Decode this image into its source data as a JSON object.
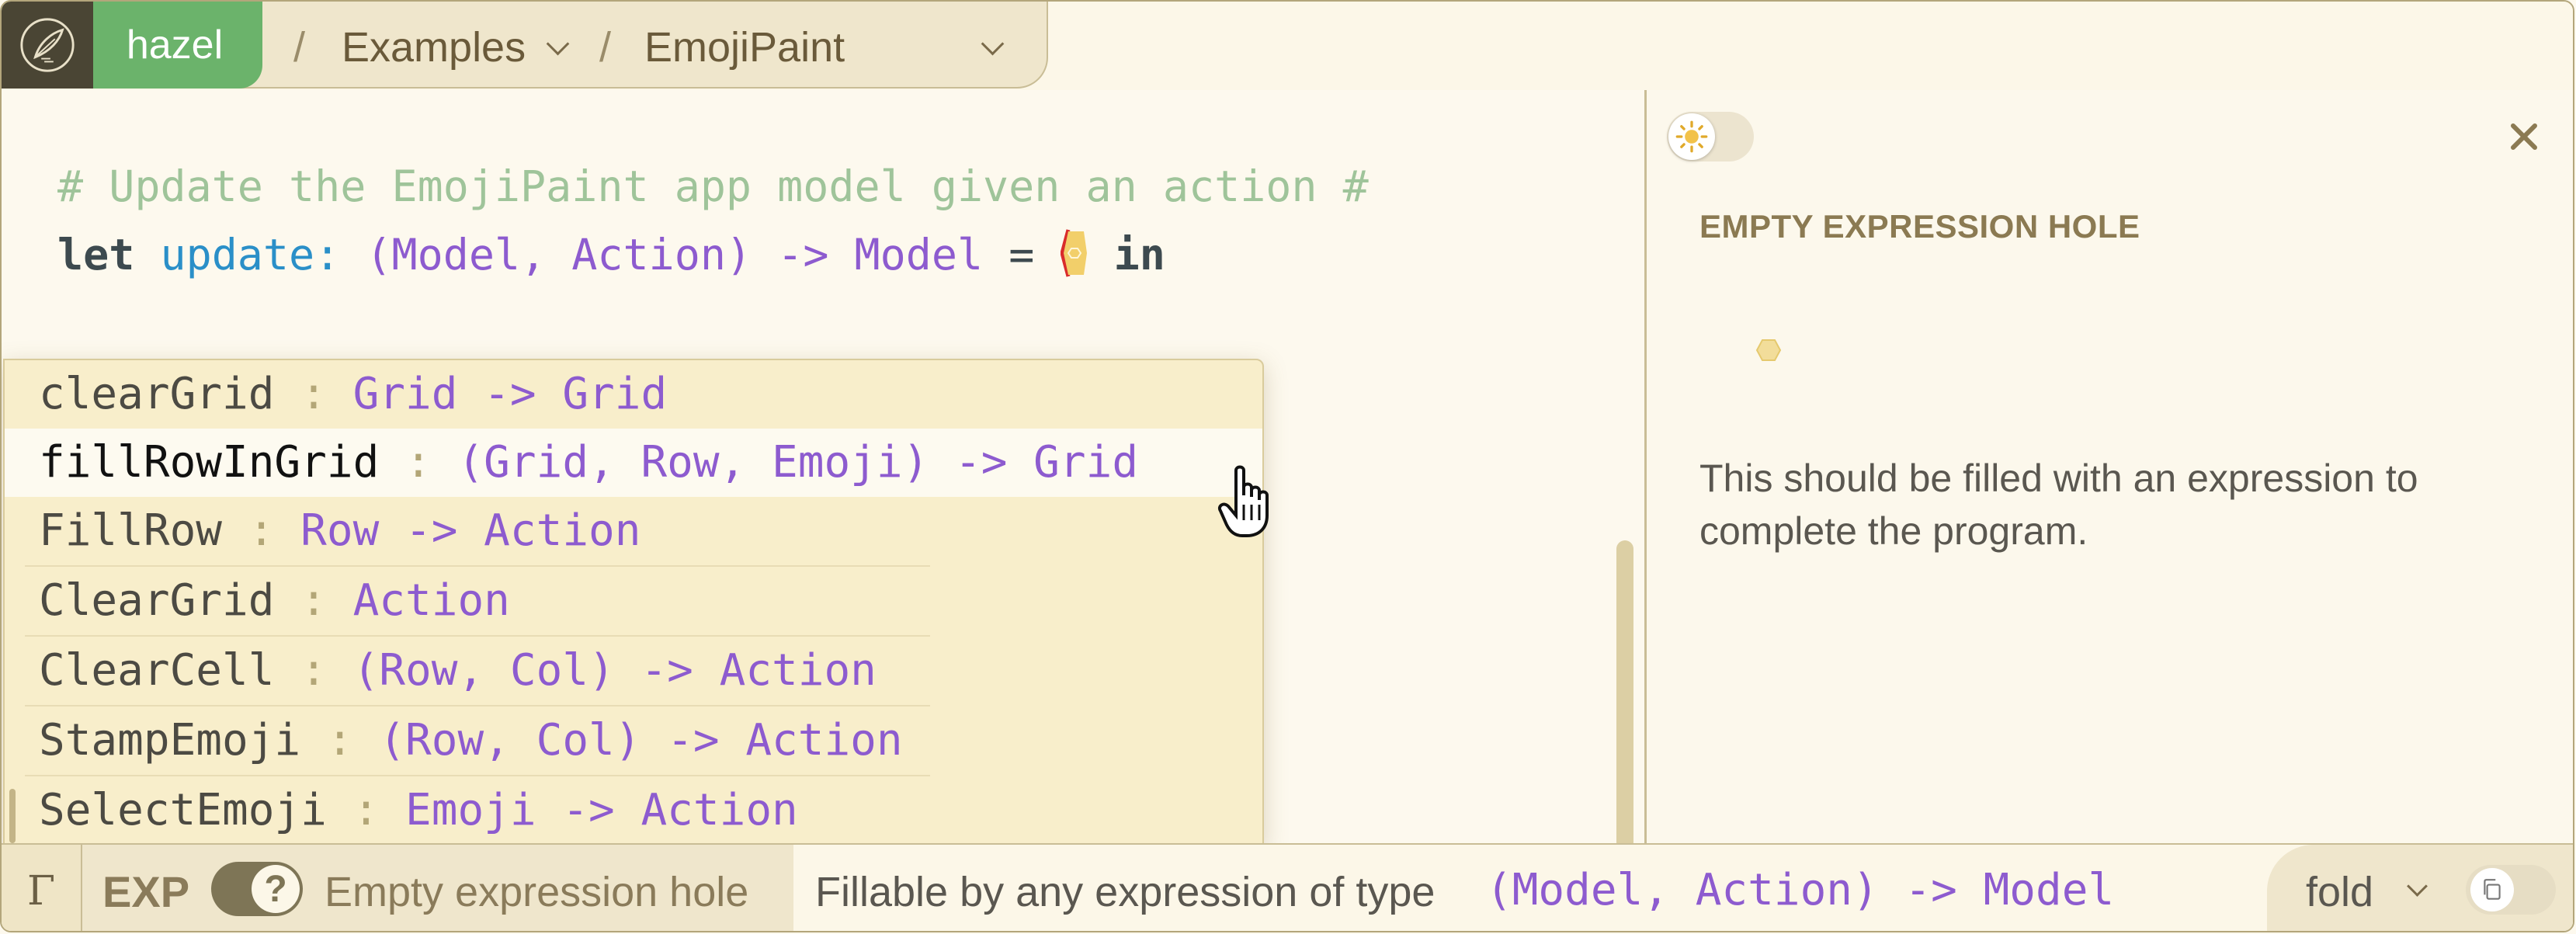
{
  "header": {
    "app_name": "hazel",
    "breadcrumb_sep": "/",
    "crumb_examples": "Examples",
    "crumb_current": "EmojiPaint"
  },
  "editor": {
    "line1": "# Update the EmojiPaint app model given an action #",
    "line2": {
      "kw_let": "let",
      "name": "update",
      "colon": ":",
      "type": "(Model, Action) -> Model",
      "eq": "=",
      "kw_in": "in"
    }
  },
  "completions": [
    {
      "name": "clearGrid",
      "colon": " : ",
      "type": "Grid -> Grid",
      "selected": false
    },
    {
      "name": "fillRowInGrid",
      "colon": " : ",
      "type": "(Grid, Row, Emoji) -> Grid",
      "selected": true
    },
    {
      "name": "FillRow",
      "colon": " : ",
      "type": "Row -> Action",
      "selected": false
    },
    {
      "name": "ClearGrid",
      "colon": " : ",
      "type": "Action",
      "selected": false
    },
    {
      "name": "ClearCell",
      "colon": " : ",
      "type": "(Row, Col) -> Action",
      "selected": false
    },
    {
      "name": "StampEmoji",
      "colon": " : ",
      "type": "(Row, Col) -> Action",
      "selected": false
    },
    {
      "name": "SelectEmoji",
      "colon": " : ",
      "type": "Emoji -> Action",
      "selected": false
    }
  ],
  "inspector": {
    "title": "EMPTY EXPRESSION HOLE",
    "description": "This should be filled with an expression to complete the program."
  },
  "status": {
    "gamma": "Γ",
    "mode": "EXP",
    "help_glyph": "?",
    "hole_label": "Empty expression hole",
    "fillable_text": "Fillable by any expression of type",
    "fillable_type": "(Model, Action) -> Model",
    "fold_label": "fold"
  },
  "colors": {
    "accent_green": "#6bb36b",
    "type_purple": "#8d5bcf",
    "var_blue": "#2a8fc8",
    "comment_green": "#9fc49a",
    "hole_red": "#d92b2b",
    "hole_yellow": "#f2cf6a"
  },
  "icons": [
    "hazel-logo-icon",
    "chevron-down-icon",
    "sun-icon",
    "close-icon",
    "empty-hole-icon",
    "hand-cursor-icon",
    "help-icon",
    "copy-icon"
  ]
}
